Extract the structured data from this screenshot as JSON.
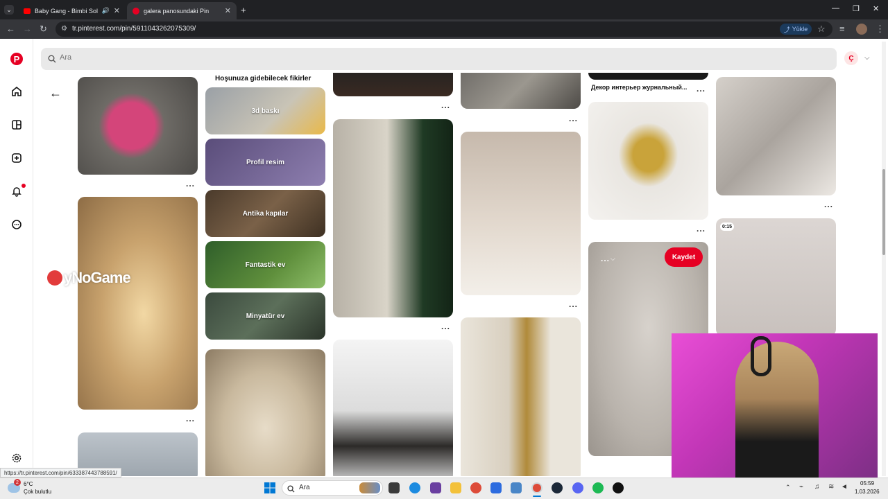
{
  "browser": {
    "tabs": [
      {
        "title": "Baby Gang - Bimbi Soldato",
        "audio_icon": "speaker-icon"
      },
      {
        "title": "galera panosundaki Pin"
      }
    ],
    "new_tab": "+",
    "url": "tr.pinterest.com/pin/5911043262075309/",
    "upload_label": "Yükle",
    "window_controls": [
      "—",
      "❐",
      "✕"
    ]
  },
  "pinterest": {
    "search_placeholder": "Ara",
    "avatar_initial": "Ç",
    "ideas_heading": "Hoşunuza gidebilecek fikirler",
    "ideas": [
      "3d baskı",
      "Profil resim",
      "Antika kapılar",
      "Fantastik ev",
      "Minyatür ev"
    ],
    "pin_titles": [
      "Декор интерьер журнальный..."
    ],
    "save_button": "Kaydet",
    "video_duration": "0:15",
    "more_dots": "..."
  },
  "overlay": {
    "watermark_text": "yNoGame",
    "status_url": "https://tr.pinterest.com/pin/633387443788591/"
  },
  "taskbar": {
    "weather_temp": "6°C",
    "weather_desc": "Çok bulutlu",
    "weather_badge": "2",
    "search_label": "Ara",
    "date": "1.03.2026",
    "time": "05:59"
  },
  "colors": {
    "pinterest_red": "#e60023",
    "chrome_dark": "#202124",
    "chrome_toolbar": "#35363a"
  }
}
